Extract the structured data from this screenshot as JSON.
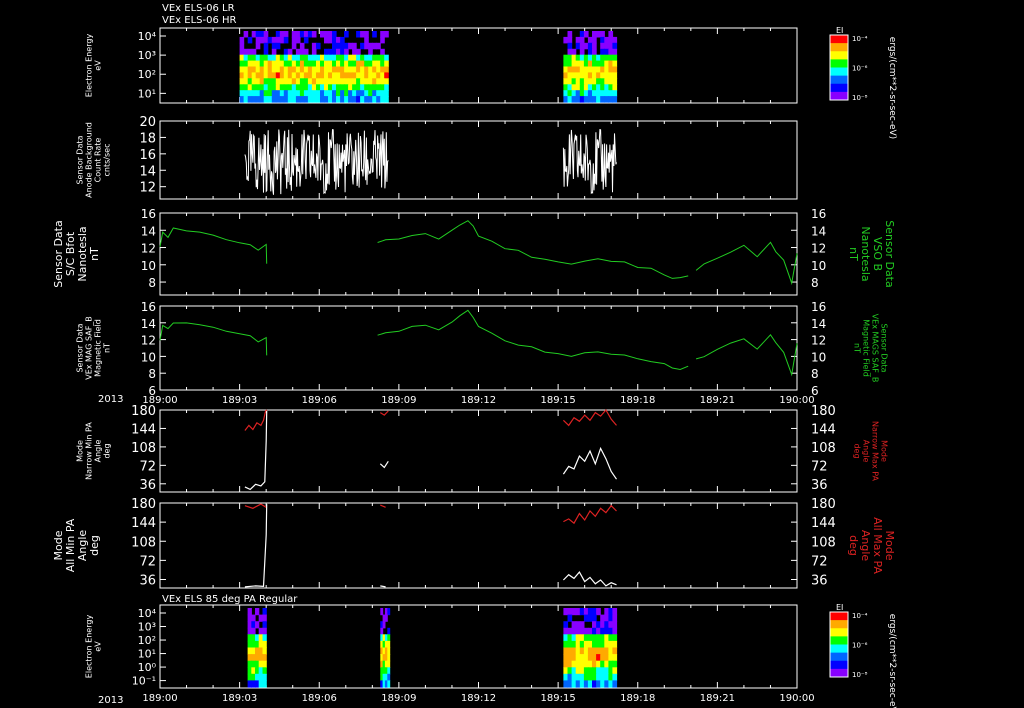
{
  "header": {
    "title_lr": "VEx ELS-06 LR",
    "title_hr": "VEx ELS-06 HR",
    "bottom_title": "VEx ELS 85 deg PA Regular",
    "year_label": "2013"
  },
  "time_axis": {
    "ticks": [
      "189:00",
      "189:03",
      "189:06",
      "189:09",
      "189:12",
      "189:15",
      "189:18",
      "189:21",
      "190:00"
    ]
  },
  "colors": {
    "background": "#000000",
    "axis": "#ffffff",
    "mag_trace": "#22cc22",
    "max_pa": "#dd2222",
    "min_pa": "#ffffff",
    "colorbar": [
      "#ff0000",
      "#ffaa00",
      "#ffff00",
      "#00ff00",
      "#00ffff",
      "#0066ff",
      "#0000ff",
      "#8800ff"
    ]
  },
  "chart_data": [
    {
      "type": "heatmap",
      "title": "VEx ELS-06 LR / VEx ELS-06 HR",
      "ylabel": [
        "Electron Energy",
        "eV"
      ],
      "yticks": [
        "10⁴",
        "10³",
        "10²",
        "10¹"
      ],
      "log_y": true,
      "colorbar": {
        "label": "EI",
        "ticks": [
          "10⁻⁴",
          "10⁻⁶",
          "10⁻⁸"
        ],
        "units": "ergs/(cm**2-sr-sec-eV)"
      },
      "data_intervals": [
        [
          "189:03",
          "189:08.6"
        ],
        [
          "189:15.2",
          "189:17.2"
        ]
      ]
    },
    {
      "type": "line",
      "ylabel": [
        "Sensor Data",
        "Anode Background",
        "Count Rate",
        "cnts/sec"
      ],
      "ylim": [
        10.5,
        20
      ],
      "yticks": [
        12,
        14,
        16,
        18,
        20
      ],
      "series": [
        {
          "x_intervals": [
            [
              "189:03.2",
              "189:08.6"
            ],
            [
              "189:15.2",
              "189:17.2"
            ]
          ],
          "range": [
            11,
            19
          ]
        }
      ]
    },
    {
      "type": "line",
      "ylabel": [
        "Sensor Data",
        "S/C Bfot",
        "Nanotesla",
        "nT"
      ],
      "ylabel_right": [
        "Sensor Data",
        "VSO B",
        "Nanotesla",
        "nT"
      ],
      "ylim": [
        6.5,
        16
      ],
      "yticks": [
        8,
        10,
        12,
        14,
        16
      ],
      "series": [
        {
          "x": [
            0,
            0.1,
            0.3,
            0.5,
            1,
            1.5,
            2,
            2.5,
            3,
            3.4,
            3.7,
            4,
            4.02,
            8.2,
            8.5,
            9,
            9.5,
            10,
            10.5,
            11,
            11.3,
            11.6,
            11.8,
            12,
            12.5,
            13,
            13.5,
            14,
            14.5,
            15,
            15.5,
            16,
            16.5,
            17,
            17.5,
            18,
            18.5,
            19,
            19.3,
            19.6,
            19.9,
            20.2,
            20.5,
            21,
            21.5,
            22,
            22.5,
            23,
            23.2,
            23.5,
            23.8,
            24
          ],
          "y": [
            12,
            13.8,
            13.2,
            14.1,
            14,
            13.8,
            13.5,
            13,
            12.5,
            12.3,
            11.8,
            12.2,
            10,
            12.5,
            13,
            13,
            13.4,
            13.6,
            13,
            14.2,
            14.8,
            15.3,
            14.5,
            13.5,
            12.8,
            12,
            11.5,
            11,
            10.5,
            10.2,
            10,
            10.3,
            10.5,
            10.2,
            10.3,
            9.8,
            9.5,
            9,
            8.5,
            8.4,
            8.8,
            9.5,
            10,
            10.8,
            11.5,
            12.2,
            11,
            12.5,
            11.5,
            10.5,
            7.8,
            11.5
          ],
          "gaps_after_x": [
            4.02,
            19.9
          ]
        }
      ]
    },
    {
      "type": "line",
      "ylabel": [
        "Sensor Data",
        "VEx MAG SAF_B",
        "Magnetic Field",
        "nT"
      ],
      "ylabel_right": [
        "Sensor Data",
        "VEx MAGS SAF_B",
        "Magnetic Field",
        "nT"
      ],
      "ylim": [
        6,
        16
      ],
      "yticks": [
        6,
        8,
        10,
        12,
        14,
        16
      ],
      "series": [
        {
          "x": [
            0,
            0.1,
            0.3,
            0.5,
            1,
            1.5,
            2,
            2.5,
            3,
            3.4,
            3.7,
            4,
            4.02,
            8.2,
            8.5,
            9,
            9.5,
            10,
            10.5,
            11,
            11.3,
            11.6,
            11.8,
            12,
            12.5,
            13,
            13.5,
            14,
            14.5,
            15,
            15.5,
            16,
            16.5,
            17,
            17.5,
            18,
            18.5,
            19,
            19.3,
            19.6,
            19.9,
            20.2,
            20.5,
            21,
            21.5,
            22,
            22.5,
            23,
            23.2,
            23.5,
            23.8,
            24
          ],
          "y": [
            12,
            13.8,
            13.2,
            14.1,
            14,
            13.8,
            13.5,
            13,
            12.5,
            12.3,
            11.8,
            12.2,
            10,
            12.5,
            13,
            13,
            13.4,
            13.6,
            13,
            14.2,
            14.8,
            15.3,
            14.5,
            13.5,
            12.8,
            12,
            11.5,
            11,
            10.5,
            10.2,
            10,
            10.3,
            10.5,
            10.2,
            10.3,
            9.8,
            9.5,
            9,
            8.5,
            8.4,
            8.8,
            9.5,
            10,
            10.8,
            11.5,
            12.2,
            11,
            12.5,
            11.5,
            10.5,
            7.8,
            11.5
          ],
          "gaps_after_x": [
            4.02,
            19.9
          ]
        }
      ]
    },
    {
      "type": "line",
      "ylabel": [
        "Mode",
        "Narrow Min PA",
        "Angle",
        "deg"
      ],
      "ylabel_right": [
        "Mode",
        "Narrow Max PA",
        "Angle",
        "deg"
      ],
      "ylim": [
        20,
        180
      ],
      "yticks": [
        36,
        72,
        108,
        144,
        180
      ],
      "series": [
        {
          "name": "Max PA",
          "color": "#dd2222",
          "segments": [
            {
              "x": [
                3.2,
                3.35,
                3.5,
                3.65,
                3.8,
                3.9,
                3.98,
                4.02
              ],
              "y": [
                140,
                150,
                142,
                155,
                150,
                160,
                178,
                180
              ]
            },
            {
              "x": [
                8.3,
                8.45,
                8.6
              ],
              "y": [
                175,
                170,
                178
              ]
            },
            {
              "x": [
                15.2,
                15.4,
                15.6,
                15.8,
                16,
                16.2,
                16.4,
                16.6,
                16.8,
                17,
                17.2
              ],
              "y": [
                160,
                150,
                165,
                158,
                170,
                160,
                175,
                168,
                180,
                162,
                150
              ]
            }
          ]
        },
        {
          "name": "Min PA",
          "color": "#ffffff",
          "segments": [
            {
              "x": [
                3.2,
                3.4,
                3.6,
                3.8,
                3.95,
                4.0,
                4.02
              ],
              "y": [
                30,
                25,
                35,
                32,
                40,
                120,
                178
              ]
            },
            {
              "x": [
                8.3,
                8.45,
                8.6
              ],
              "y": [
                75,
                68,
                80
              ]
            },
            {
              "x": [
                15.2,
                15.4,
                15.6,
                15.8,
                16,
                16.2,
                16.4,
                16.6,
                16.8,
                17,
                17.2
              ],
              "y": [
                55,
                70,
                65,
                90,
                80,
                100,
                75,
                105,
                85,
                60,
                45
              ]
            }
          ]
        }
      ]
    },
    {
      "type": "line",
      "ylabel": [
        "Mode",
        "All Min PA",
        "Angle",
        "deg"
      ],
      "ylabel_right": [
        "Mode",
        "All Max PA",
        "Angle",
        "deg"
      ],
      "ylim": [
        20,
        180
      ],
      "yticks": [
        36,
        72,
        108,
        144,
        180
      ],
      "series": [
        {
          "name": "Max PA",
          "color": "#dd2222",
          "segments": [
            {
              "x": [
                3.2,
                3.5,
                3.8,
                4.0
              ],
              "y": [
                175,
                170,
                178,
                172
              ]
            },
            {
              "x": [
                8.3,
                8.5
              ],
              "y": [
                176,
                172
              ]
            },
            {
              "x": [
                15.2,
                15.4,
                15.6,
                15.8,
                16,
                16.2,
                16.4,
                16.6,
                16.8,
                17,
                17.2
              ],
              "y": [
                145,
                150,
                142,
                160,
                148,
                165,
                155,
                170,
                162,
                175,
                165
              ]
            }
          ]
        },
        {
          "name": "Min PA",
          "color": "#ffffff",
          "segments": [
            {
              "x": [
                3.2,
                3.6,
                3.9,
                4.0,
                4.02
              ],
              "y": [
                22,
                24,
                23,
                120,
                178
              ]
            },
            {
              "x": [
                8.3,
                8.5
              ],
              "y": [
                24,
                22
              ]
            },
            {
              "x": [
                15.2,
                15.4,
                15.6,
                15.8,
                16,
                16.2,
                16.4,
                16.6,
                16.8,
                17,
                17.2
              ],
              "y": [
                35,
                45,
                38,
                50,
                32,
                40,
                28,
                35,
                24,
                30,
                26
              ]
            }
          ]
        }
      ]
    },
    {
      "type": "heatmap",
      "title": "VEx ELS 85 deg PA Regular",
      "ylabel": [
        "Electron Energy",
        "eV"
      ],
      "yticks": [
        "10⁴",
        "10³",
        "10²",
        "10¹",
        "10⁰",
        "10⁻¹"
      ],
      "log_y": true,
      "colorbar": {
        "label": "EI",
        "ticks": [
          "10⁻⁴",
          "10⁻⁶",
          "10⁻⁸"
        ],
        "units": "ergs/(cm**2-sr-sec-eV)"
      },
      "data_intervals": [
        [
          "189:03.3",
          "189:04"
        ],
        [
          "189:08.3",
          "189:08.65"
        ],
        [
          "189:15.2",
          "189:17.2"
        ]
      ]
    }
  ]
}
